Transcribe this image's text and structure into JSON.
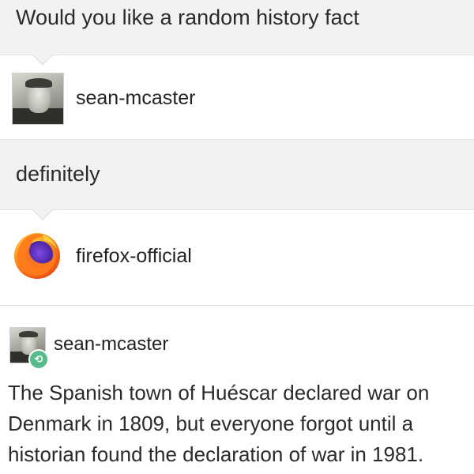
{
  "thread": {
    "message_1": "Would you like a random history fact",
    "author_1": "sean-mcaster",
    "message_2": "definitely",
    "author_2": "firefox-official"
  },
  "reblog": {
    "author": "sean-mcaster",
    "body_lines": [
      "The Spanish town of Huéscar declared war on",
      "Denmark in 1809, but everyone forgot until a",
      "historian found the declaration of war in 1981."
    ]
  },
  "colors": {
    "bubble_bg": "#f2f2f2",
    "reblog_badge": "#56bc8a",
    "firefox_orange": "#f97e1d",
    "firefox_purple": "#5b2bb5"
  },
  "icons": {
    "avatar_1": "photo-avatar",
    "avatar_2": "firefox-logo-icon",
    "reblog": "reblog-icon"
  }
}
